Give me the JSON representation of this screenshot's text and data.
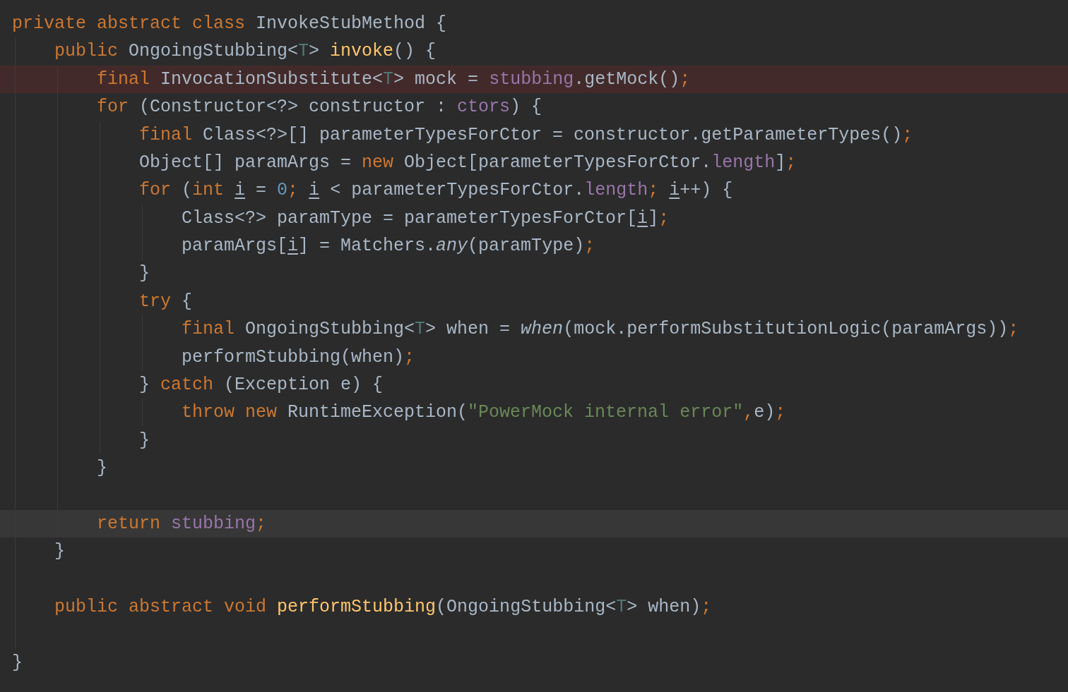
{
  "editor": {
    "lines": [
      {
        "error_highlight": false,
        "current_line": false,
        "tokens": [
          {
            "text": "private abstract class",
            "kind": "keyword"
          },
          {
            "text": " InvokeStubMethod {",
            "kind": "plain"
          }
        ],
        "children": [
          {
            "error_highlight": false,
            "current_line": false,
            "tokens": [
              {
                "text": "public",
                "kind": "keyword"
              },
              {
                "text": " OngoingStubbing<",
                "kind": "plain"
              },
              {
                "text": "T",
                "kind": "typeparam"
              },
              {
                "text": "> ",
                "kind": "plain"
              },
              {
                "text": "invoke",
                "kind": "declaration"
              },
              {
                "text": "() {",
                "kind": "plain"
              }
            ],
            "children": [
              {
                "error_highlight": true,
                "current_line": false,
                "tokens": [
                  {
                    "text": "final",
                    "kind": "keyword"
                  },
                  {
                    "text": " InvocationSubstitute<",
                    "kind": "plain"
                  },
                  {
                    "text": "T",
                    "kind": "typeparam"
                  },
                  {
                    "text": "> mock = ",
                    "kind": "plain"
                  },
                  {
                    "text": "stubbing",
                    "kind": "field"
                  },
                  {
                    "text": ".getMock()",
                    "kind": "plain"
                  },
                  {
                    "text": ";",
                    "kind": "keyword"
                  }
                ]
              },
              {
                "error_highlight": false,
                "current_line": false,
                "tokens": [
                  {
                    "text": "for",
                    "kind": "keyword"
                  },
                  {
                    "text": " (Constructor<?> constructor : ",
                    "kind": "plain"
                  },
                  {
                    "text": "ctors",
                    "kind": "field"
                  },
                  {
                    "text": ") {",
                    "kind": "plain"
                  }
                ],
                "children": [
                  {
                    "error_highlight": false,
                    "current_line": false,
                    "tokens": [
                      {
                        "text": "final",
                        "kind": "keyword"
                      },
                      {
                        "text": " Class<?>[] parameterTypesForCtor = constructor.getParameterTypes()",
                        "kind": "plain"
                      },
                      {
                        "text": ";",
                        "kind": "keyword"
                      }
                    ]
                  },
                  {
                    "error_highlight": false,
                    "current_line": false,
                    "tokens": [
                      {
                        "text": "Object[] paramArgs = ",
                        "kind": "plain"
                      },
                      {
                        "text": "new",
                        "kind": "keyword"
                      },
                      {
                        "text": " Object[parameterTypesForCtor.",
                        "kind": "plain"
                      },
                      {
                        "text": "length",
                        "kind": "field"
                      },
                      {
                        "text": "]",
                        "kind": "plain"
                      },
                      {
                        "text": ";",
                        "kind": "keyword"
                      }
                    ]
                  },
                  {
                    "error_highlight": false,
                    "current_line": false,
                    "tokens": [
                      {
                        "text": "for",
                        "kind": "keyword"
                      },
                      {
                        "text": " (",
                        "kind": "plain"
                      },
                      {
                        "text": "int ",
                        "kind": "keyword"
                      },
                      {
                        "text": "i",
                        "kind": "reassigned"
                      },
                      {
                        "text": " = ",
                        "kind": "plain"
                      },
                      {
                        "text": "0",
                        "kind": "number"
                      },
                      {
                        "text": "; ",
                        "kind": "keyword"
                      },
                      {
                        "text": "i",
                        "kind": "reassigned"
                      },
                      {
                        "text": " < parameterTypesForCtor.",
                        "kind": "plain"
                      },
                      {
                        "text": "length",
                        "kind": "field"
                      },
                      {
                        "text": "; ",
                        "kind": "keyword"
                      },
                      {
                        "text": "i",
                        "kind": "reassigned"
                      },
                      {
                        "text": "++) {",
                        "kind": "plain"
                      }
                    ],
                    "children": [
                      {
                        "error_highlight": false,
                        "current_line": false,
                        "tokens": [
                          {
                            "text": "Class<?> paramType = parameterTypesForCtor[",
                            "kind": "plain"
                          },
                          {
                            "text": "i",
                            "kind": "reassigned"
                          },
                          {
                            "text": "]",
                            "kind": "plain"
                          },
                          {
                            "text": ";",
                            "kind": "keyword"
                          }
                        ]
                      },
                      {
                        "error_highlight": false,
                        "current_line": false,
                        "tokens": [
                          {
                            "text": "paramArgs[",
                            "kind": "plain"
                          },
                          {
                            "text": "i",
                            "kind": "reassigned"
                          },
                          {
                            "text": "] = Matchers.",
                            "kind": "plain"
                          },
                          {
                            "text": "any",
                            "kind": "static"
                          },
                          {
                            "text": "(paramType)",
                            "kind": "plain"
                          },
                          {
                            "text": ";",
                            "kind": "keyword"
                          }
                        ]
                      }
                    ]
                  },
                  {
                    "error_highlight": false,
                    "current_line": false,
                    "tokens": [
                      {
                        "text": "}",
                        "kind": "plain"
                      }
                    ]
                  },
                  {
                    "error_highlight": false,
                    "current_line": false,
                    "tokens": [
                      {
                        "text": "try",
                        "kind": "keyword"
                      },
                      {
                        "text": " {",
                        "kind": "plain"
                      }
                    ],
                    "children": [
                      {
                        "error_highlight": false,
                        "current_line": false,
                        "tokens": [
                          {
                            "text": "final",
                            "kind": "keyword"
                          },
                          {
                            "text": " OngoingStubbing<",
                            "kind": "plain"
                          },
                          {
                            "text": "T",
                            "kind": "typeparam"
                          },
                          {
                            "text": "> when = ",
                            "kind": "plain"
                          },
                          {
                            "text": "when",
                            "kind": "static"
                          },
                          {
                            "text": "(mock.performSubstitutionLogic(paramArgs))",
                            "kind": "plain"
                          },
                          {
                            "text": ";",
                            "kind": "keyword"
                          }
                        ]
                      },
                      {
                        "error_highlight": false,
                        "current_line": false,
                        "tokens": [
                          {
                            "text": "performStubbing(when)",
                            "kind": "plain"
                          },
                          {
                            "text": ";",
                            "kind": "keyword"
                          }
                        ]
                      }
                    ]
                  },
                  {
                    "error_highlight": false,
                    "current_line": false,
                    "tokens": [
                      {
                        "text": "} ",
                        "kind": "plain"
                      },
                      {
                        "text": "catch",
                        "kind": "keyword"
                      },
                      {
                        "text": " (Exception e) {",
                        "kind": "plain"
                      }
                    ],
                    "children": [
                      {
                        "error_highlight": false,
                        "current_line": false,
                        "tokens": [
                          {
                            "text": "throw new",
                            "kind": "keyword"
                          },
                          {
                            "text": " RuntimeException(",
                            "kind": "plain"
                          },
                          {
                            "text": "\"PowerMock internal error\"",
                            "kind": "string"
                          },
                          {
                            "text": ",",
                            "kind": "keyword"
                          },
                          {
                            "text": "e)",
                            "kind": "plain"
                          },
                          {
                            "text": ";",
                            "kind": "keyword"
                          }
                        ]
                      }
                    ]
                  },
                  {
                    "error_highlight": false,
                    "current_line": false,
                    "tokens": [
                      {
                        "text": "}",
                        "kind": "plain"
                      }
                    ]
                  }
                ]
              },
              {
                "error_highlight": false,
                "current_line": false,
                "tokens": [
                  {
                    "text": "}",
                    "kind": "plain"
                  }
                ]
              },
              {
                "error_highlight": false,
                "current_line": false
              },
              {
                "error_highlight": false,
                "current_line": true,
                "tokens": [
                  {
                    "text": "return ",
                    "kind": "keyword"
                  },
                  {
                    "text": "stubbing",
                    "kind": "field"
                  },
                  {
                    "text": ";",
                    "kind": "keyword"
                  }
                ]
              }
            ]
          },
          {
            "error_highlight": false,
            "current_line": false,
            "tokens": [
              {
                "text": "}",
                "kind": "plain"
              }
            ]
          },
          {
            "error_highlight": false,
            "current_line": false
          },
          {
            "error_highlight": false,
            "current_line": false,
            "tokens": [
              {
                "text": "public abstract void ",
                "kind": "keyword"
              },
              {
                "text": "performStubbing",
                "kind": "declaration"
              },
              {
                "text": "(OngoingStubbing<",
                "kind": "plain"
              },
              {
                "text": "T",
                "kind": "typeparam"
              },
              {
                "text": "> when)",
                "kind": "plain"
              },
              {
                "text": ";",
                "kind": "keyword"
              }
            ]
          },
          {
            "error_highlight": false,
            "current_line": false
          }
        ]
      },
      {
        "error_highlight": false,
        "current_line": false,
        "tokens": [
          {
            "text": "}",
            "kind": "plain"
          }
        ]
      }
    ]
  }
}
